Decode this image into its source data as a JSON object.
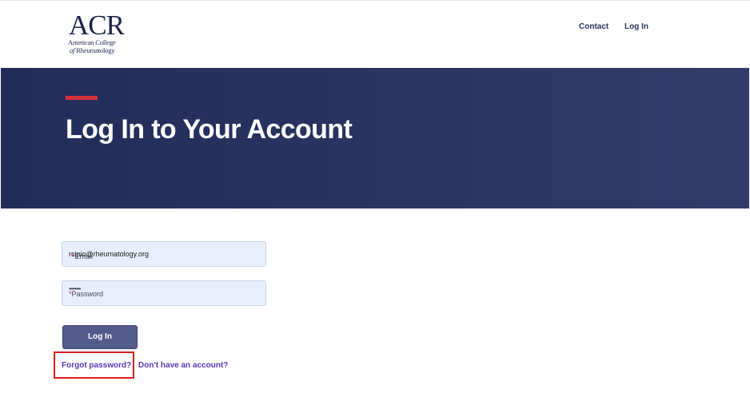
{
  "header": {
    "logo": {
      "acronym": "ACR",
      "line1": "American College",
      "line2_prefix": "of",
      "line2_rest": "Rheumatology"
    },
    "nav": {
      "contact": "Contact",
      "login": "Log In"
    }
  },
  "hero": {
    "title": "Log In to Your Account",
    "accent_color": "#d6303f"
  },
  "form": {
    "email": {
      "label": "Email",
      "required_marker": "*",
      "value": "rcipio@rheumatology.org"
    },
    "password": {
      "label": "Password",
      "required_marker": "*",
      "masked_value": "••••••••"
    },
    "submit_label": "Log In",
    "forgot_link": "Forgot password?",
    "signup_link": "Don't have an account?"
  },
  "colors": {
    "brand_navy": "#222c58",
    "button": "#535a8c",
    "link": "#5b35b8",
    "field_bg": "#e8eefb",
    "highlight": "#e01b1b"
  }
}
